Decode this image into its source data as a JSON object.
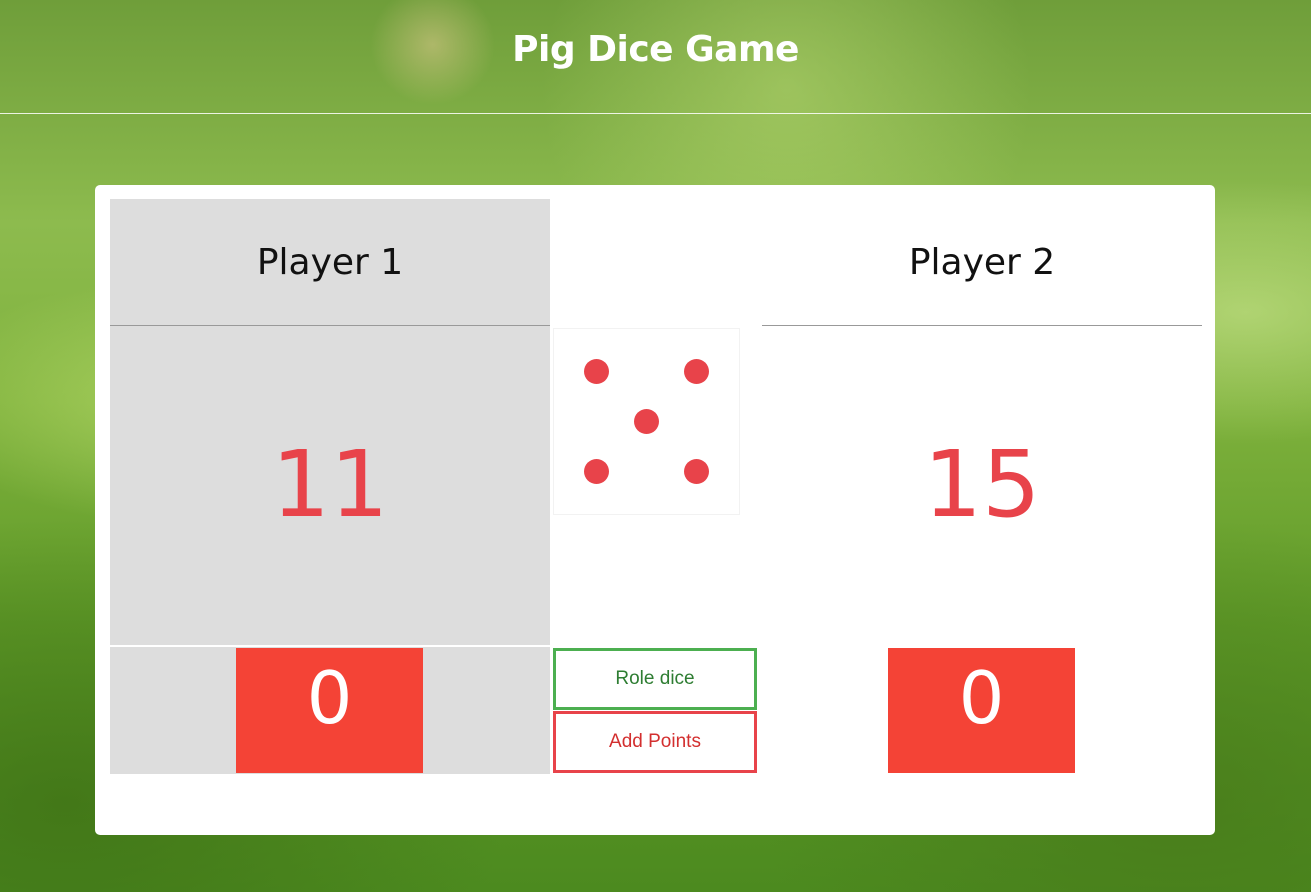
{
  "header": {
    "title": "Pig Dice Game"
  },
  "players": [
    {
      "name": "Player 1",
      "total_score": "11",
      "current_score": "0",
      "active": true
    },
    {
      "name": "Player 2",
      "total_score": "15",
      "current_score": "0",
      "active": false
    }
  ],
  "dice": {
    "value": 5,
    "pip_color": "#e8434a"
  },
  "controls": {
    "roll_label": "Role dice",
    "add_label": "Add Points"
  },
  "colors": {
    "score_red": "#e8434a",
    "current_box": "#f44336",
    "roll_border": "#4caf50",
    "add_border": "#e8434a",
    "active_panel": "#dddddd"
  }
}
